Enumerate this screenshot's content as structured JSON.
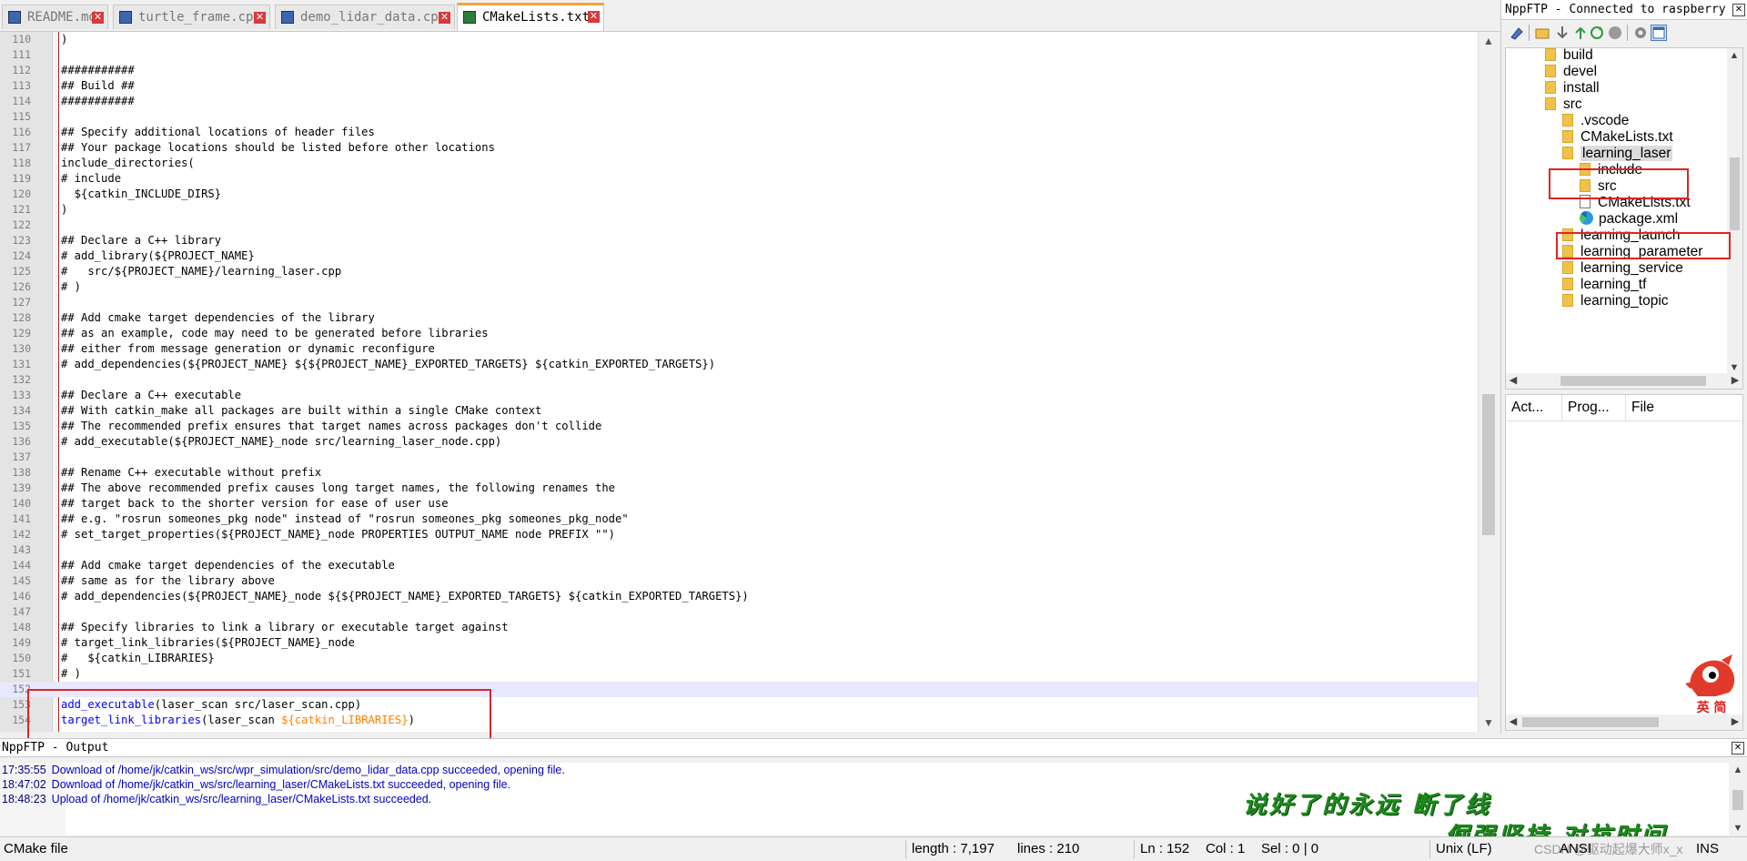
{
  "tabs": [
    {
      "label": "README.md",
      "active": false
    },
    {
      "label": "turtle_frame.cpp",
      "active": false
    },
    {
      "label": "demo_lidar_data.cpp",
      "active": false
    },
    {
      "label": "CMakeLists.txt",
      "active": true
    }
  ],
  "editor": {
    "current_line": 152,
    "lines": [
      {
        "n": "110",
        "t": "comment",
        "s": ")"
      },
      {
        "n": "111",
        "t": "comment",
        "s": ""
      },
      {
        "n": "112",
        "t": "comment",
        "s": "###########"
      },
      {
        "n": "113",
        "t": "comment",
        "s": "## Build ##"
      },
      {
        "n": "114",
        "t": "comment",
        "s": "###########"
      },
      {
        "n": "115",
        "t": "comment",
        "s": ""
      },
      {
        "n": "116",
        "t": "comment",
        "s": "## Specify additional locations of header files"
      },
      {
        "n": "117",
        "t": "comment",
        "s": "## Your package locations should be listed before other locations"
      },
      {
        "n": "118",
        "t": "func",
        "s": "include_directories("
      },
      {
        "n": "119",
        "t": "comment",
        "s": "# include"
      },
      {
        "n": "120",
        "t": "var",
        "s": "  ${catkin_INCLUDE_DIRS}"
      },
      {
        "n": "121",
        "t": "comment",
        "s": ")"
      },
      {
        "n": "122",
        "t": "comment",
        "s": ""
      },
      {
        "n": "123",
        "t": "comment",
        "s": "## Declare a C++ library"
      },
      {
        "n": "124",
        "t": "comment",
        "s": "# add_library(${PROJECT_NAME}"
      },
      {
        "n": "125",
        "t": "comment",
        "s": "#   src/${PROJECT_NAME}/learning_laser.cpp"
      },
      {
        "n": "126",
        "t": "comment",
        "s": "# )"
      },
      {
        "n": "127",
        "t": "comment",
        "s": ""
      },
      {
        "n": "128",
        "t": "comment",
        "s": "## Add cmake target dependencies of the library"
      },
      {
        "n": "129",
        "t": "comment",
        "s": "## as an example, code may need to be generated before libraries"
      },
      {
        "n": "130",
        "t": "comment",
        "s": "## either from message generation or dynamic reconfigure"
      },
      {
        "n": "131",
        "t": "comment",
        "s": "# add_dependencies(${PROJECT_NAME} ${${PROJECT_NAME}_EXPORTED_TARGETS} ${catkin_EXPORTED_TARGETS})"
      },
      {
        "n": "132",
        "t": "comment",
        "s": ""
      },
      {
        "n": "133",
        "t": "comment",
        "s": "## Declare a C++ executable"
      },
      {
        "n": "134",
        "t": "comment",
        "s": "## With catkin_make all packages are built within a single CMake context"
      },
      {
        "n": "135",
        "t": "comment",
        "s": "## The recommended prefix ensures that target names across packages don't collide"
      },
      {
        "n": "136",
        "t": "comment",
        "s": "# add_executable(${PROJECT_NAME}_node src/learning_laser_node.cpp)"
      },
      {
        "n": "137",
        "t": "comment",
        "s": ""
      },
      {
        "n": "138",
        "t": "comment",
        "s": "## Rename C++ executable without prefix"
      },
      {
        "n": "139",
        "t": "comment",
        "s": "## The above recommended prefix causes long target names, the following renames the"
      },
      {
        "n": "140",
        "t": "comment",
        "s": "## target back to the shorter version for ease of user use"
      },
      {
        "n": "141",
        "t": "comment",
        "s": "## e.g. \"rosrun someones_pkg node\" instead of \"rosrun someones_pkg someones_pkg_node\""
      },
      {
        "n": "142",
        "t": "comment",
        "s": "# set_target_properties(${PROJECT_NAME}_node PROPERTIES OUTPUT_NAME node PREFIX \"\")"
      },
      {
        "n": "143",
        "t": "comment",
        "s": ""
      },
      {
        "n": "144",
        "t": "comment",
        "s": "## Add cmake target dependencies of the executable"
      },
      {
        "n": "145",
        "t": "comment",
        "s": "## same as for the library above"
      },
      {
        "n": "146",
        "t": "comment",
        "s": "# add_dependencies(${PROJECT_NAME}_node ${${PROJECT_NAME}_EXPORTED_TARGETS} ${catkin_EXPORTED_TARGETS})"
      },
      {
        "n": "147",
        "t": "comment",
        "s": ""
      },
      {
        "n": "148",
        "t": "comment",
        "s": "## Specify libraries to link a library or executable target against"
      },
      {
        "n": "149",
        "t": "comment",
        "s": "# target_link_libraries(${PROJECT_NAME}_node"
      },
      {
        "n": "150",
        "t": "comment",
        "s": "#   ${catkin_LIBRARIES}"
      },
      {
        "n": "151",
        "t": "comment",
        "s": "# )"
      },
      {
        "n": "152",
        "t": "plain",
        "s": ""
      },
      {
        "n": "153",
        "t": "mixed",
        "parts": [
          [
            "func",
            "add_executable"
          ],
          [
            "plain",
            "(laser_scan src/laser_scan.cpp)"
          ]
        ]
      },
      {
        "n": "154",
        "t": "mixed",
        "parts": [
          [
            "func",
            "target_link_libraries"
          ],
          [
            "plain",
            "(laser_scan "
          ],
          [
            "var",
            "${catkin_LIBRARIES}"
          ],
          [
            "plain",
            ")"
          ]
        ]
      }
    ]
  },
  "ftp": {
    "title": "NppFTP - Connected to raspberry",
    "tree": [
      {
        "label": "build",
        "depth": 0,
        "kind": "folder"
      },
      {
        "label": "devel",
        "depth": 0,
        "kind": "folder"
      },
      {
        "label": "install",
        "depth": 0,
        "kind": "folder"
      },
      {
        "label": "src",
        "depth": 0,
        "kind": "folder"
      },
      {
        "label": ".vscode",
        "depth": 1,
        "kind": "folder"
      },
      {
        "label": "CMakeLists.txt",
        "depth": 1,
        "kind": "folder"
      },
      {
        "label": "learning_laser",
        "depth": 1,
        "kind": "folder",
        "selected": true
      },
      {
        "label": "include",
        "depth": 2,
        "kind": "folder"
      },
      {
        "label": "src",
        "depth": 2,
        "kind": "folder"
      },
      {
        "label": "CMakeLists.txt",
        "depth": 2,
        "kind": "file"
      },
      {
        "label": "package.xml",
        "depth": 2,
        "kind": "edge"
      },
      {
        "label": "learning_launch",
        "depth": 1,
        "kind": "folder"
      },
      {
        "label": "learning_parameter",
        "depth": 1,
        "kind": "folder"
      },
      {
        "label": "learning_service",
        "depth": 1,
        "kind": "folder"
      },
      {
        "label": "learning_tf",
        "depth": 1,
        "kind": "folder"
      },
      {
        "label": "learning_topic",
        "depth": 1,
        "kind": "folder"
      }
    ],
    "queue_headers": [
      "Act...",
      "Prog...",
      "File"
    ]
  },
  "mascot_label": "英 简",
  "output": {
    "title": "NppFTP - Output",
    "logs": [
      {
        "time": "17:35:55",
        "msg": "Download of /home/jk/catkin_ws/src/wpr_simulation/src/demo_lidar_data.cpp succeeded, opening file."
      },
      {
        "time": "18:47:02",
        "msg": "Download of /home/jk/catkin_ws/src/learning_laser/CMakeLists.txt succeeded, opening file."
      },
      {
        "time": "18:48:23",
        "msg": "Upload of /home/jk/catkin_ws/src/learning_laser/CMakeLists.txt succeeded."
      }
    ],
    "overlay_line1": "说好了的永远 断了线",
    "overlay_line2": "倔强坚持 对抗时间"
  },
  "status": {
    "file_type": "CMake file",
    "length": "length : 7,197",
    "lines": "lines : 210",
    "ln": "Ln : 152",
    "col": "Col : 1",
    "sel": "Sel : 0 | 0",
    "eol": "Unix (LF)",
    "encoding": "ANSI",
    "mode": "INS",
    "watermark": "CSDN @驱动起爆大师x_x"
  },
  "colors": {
    "comment": "#008000",
    "func": "#0000ff",
    "var": "#ff8000",
    "highlight_box": "#e02424",
    "current_line_bg": "#e8e8ff",
    "tab_accent": "#f6a13a"
  }
}
